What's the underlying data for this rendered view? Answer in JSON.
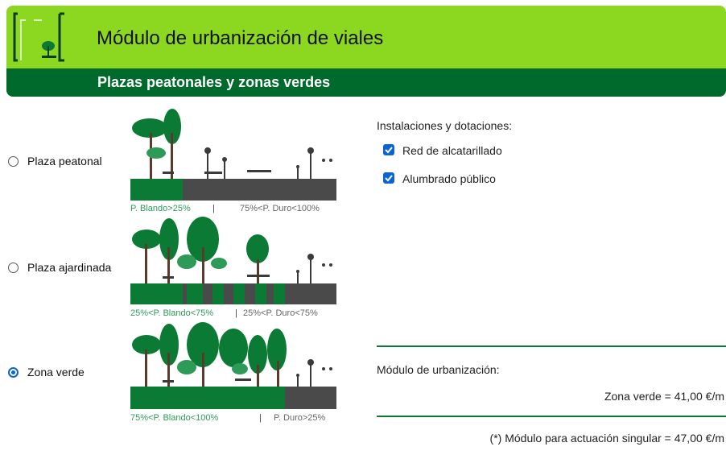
{
  "header": {
    "title": "Módulo de urbanización de viales",
    "subtitle": "Plazas peatonales y zonas verdes",
    "logo_icon": "park-bench-tree-icon"
  },
  "options": [
    {
      "label": "Plaza peatonal",
      "selected": false,
      "caption_left": "P. Blando>25%",
      "caption_sep": "|",
      "caption_right": "75%<P. Duro<100%"
    },
    {
      "label": "Plaza ajardinada",
      "selected": false,
      "caption_left": "25%<P. Blando<75%",
      "caption_sep": "|",
      "caption_right": "25%<P. Duro<75%"
    },
    {
      "label": "Zona verde",
      "selected": true,
      "caption_left": "75%<P. Blando<100%",
      "caption_sep": "|",
      "caption_right": "P. Duro>25%"
    }
  ],
  "installations": {
    "title": "Instalaciones y dotaciones:",
    "items": [
      {
        "label": "Red de alcatarillado",
        "checked": true
      },
      {
        "label": "Alumbrado público",
        "checked": true
      }
    ]
  },
  "module": {
    "title": "Módulo de urbanización:",
    "value": "Zona verde = 41,00 €/m",
    "note": "(*) Módulo para actuación singular = 47,00 €/m"
  },
  "colors": {
    "lime": "#8cd71f",
    "dark_green": "#006a2c",
    "soft_pavement": "#0a7a34",
    "hard_pavement": "#4a4a4a",
    "accent_blue": "#0b63d4"
  }
}
